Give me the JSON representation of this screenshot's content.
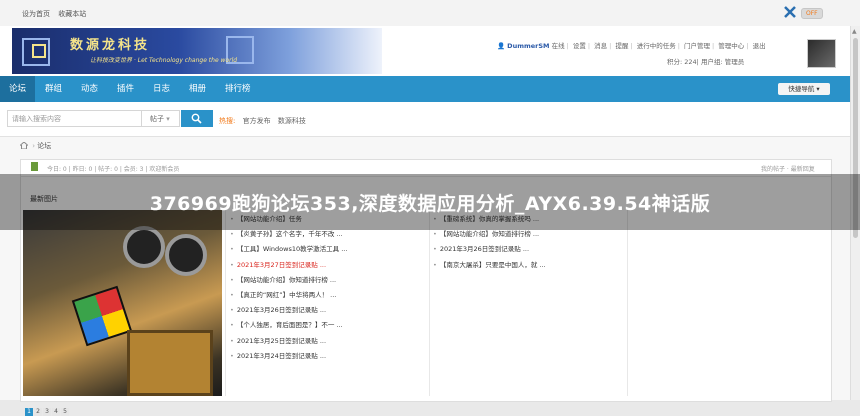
{
  "topbar": {
    "links": [
      "设为首页",
      "收藏本站"
    ],
    "off_badge": "OFF"
  },
  "banner": {
    "brand": "数源龙科技",
    "slogan": "让科技改变世界 · Let Technology change the world"
  },
  "user": {
    "name": "DummerSM",
    "status": "在线",
    "links": [
      "设置",
      "消息",
      "提醒",
      "进行中的任务",
      "门户管理",
      "管理中心",
      "退出"
    ],
    "points": "积分: 224",
    "group": "用户组: 管理员"
  },
  "nav": {
    "items": [
      "论坛",
      "群组",
      "动态",
      "插件",
      "日志",
      "相册",
      "排行榜"
    ],
    "quick": "快捷导航"
  },
  "search": {
    "placeholder": "请输入搜索内容",
    "type": "帖子",
    "hot_label": "热搜:",
    "hot": [
      "官方发布",
      "数源科技"
    ]
  },
  "breadcrumb": {
    "label": "论坛"
  },
  "forum": {
    "tab_text": "今日: 0 | 昨日: 0 | 帖子: 0 | 会员: 3 | 欢迎新会员",
    "right_link": "我的帖子 · 最新回复",
    "section_title": "最新图片",
    "pager": [
      "1",
      "2",
      "3",
      "4",
      "5"
    ],
    "col1": [
      {
        "text": "【网站功能介绍】任务",
        "red": false
      },
      {
        "text": "【炎黄子孙】这个名字，千年不改 ...",
        "red": false
      },
      {
        "text": "【工具】Windows10教学激活工具 ...",
        "red": false
      },
      {
        "text": "2021年3月27日签到记录贴 ...",
        "red": true
      },
      {
        "text": "【网站功能介绍】你知道排行榜 ...",
        "red": false
      },
      {
        "text": "【真正的“网红”】中华将两人！ ...",
        "red": false
      },
      {
        "text": "2021年3月26日签到记录贴 ...",
        "red": false
      },
      {
        "text": "【个人独居，育后面困是？】不一 ...",
        "red": false
      },
      {
        "text": "2021年3月25日签到记录贴 ...",
        "red": false
      },
      {
        "text": "2021年3月24日签到记录贴 ...",
        "red": false
      }
    ],
    "col2": [
      {
        "text": "【重磅系统】你真的掌握系统吗 ..."
      },
      {
        "text": "【网站功能介绍】你知道排行榜 ..."
      },
      {
        "text": "2021年3月26日签到记录贴 ..."
      },
      {
        "text": "【南京大屠杀】只要是中国人，就 ..."
      }
    ]
  },
  "overlay": {
    "title": "376969跑狗论坛353,深度数据应用分析_AYX6.39.54神话版"
  }
}
